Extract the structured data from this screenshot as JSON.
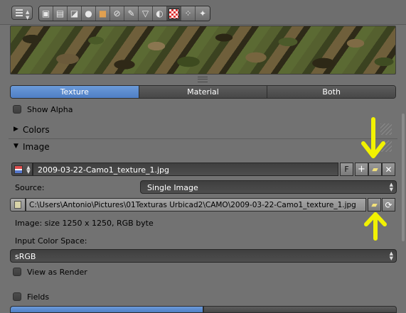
{
  "toolbar": {
    "editor_icon": "properties-editor-icon",
    "context_icons": [
      "render-icon",
      "render-layers-icon",
      "scene-icon",
      "world-icon",
      "object-icon",
      "constraints-icon",
      "modifiers-icon",
      "data-icon",
      "material-icon",
      "texture-icon",
      "particles-icon",
      "physics-icon"
    ]
  },
  "preview": {
    "label": "texture-preview"
  },
  "view_tabs": {
    "texture": "Texture",
    "material": "Material",
    "both": "Both"
  },
  "show_alpha": {
    "label": "Show Alpha",
    "checked": false
  },
  "panels": {
    "colors": "Colors",
    "image": "Image"
  },
  "image": {
    "name": "2009-03-22-Camo1_texture_1.jpg",
    "fake_user": "F",
    "source_label": "Source:",
    "source_value": "Single Image",
    "filepath": "C:\\Users\\Antonio\\Pictures\\01Texturas Urbicad2\\CAMO\\2009-03-22-Camo1_texture_1.jpg",
    "info": "Image: size 1250 x 1250, RGB byte",
    "color_space_label": "Input Color Space:",
    "color_space_value": "sRGB",
    "view_as_render": "View as Render",
    "fields": "Fields"
  },
  "colors": {
    "accent": "#5a8ad0",
    "annotation": "#f2f200"
  }
}
